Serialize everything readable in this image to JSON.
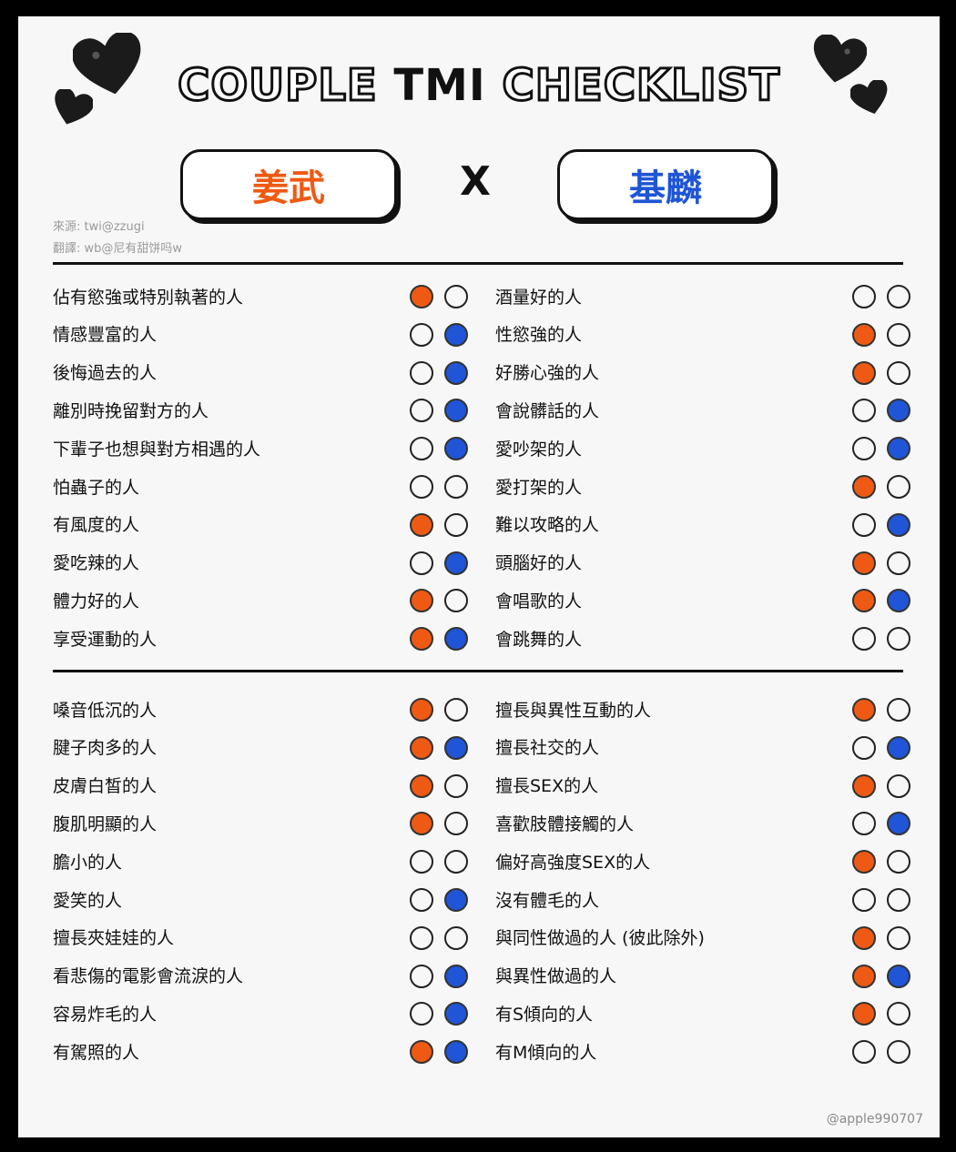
{
  "header": {
    "title_a": "COUPLE",
    "title_b": "TMI",
    "title_c": "CHECKLIST",
    "name_left": "姜武",
    "name_right": "基麟",
    "x_mark": "X"
  },
  "credits": {
    "source": "來源: twi@zzugi",
    "translation": "翻譯: wb@尼有甜饼吗w"
  },
  "colors": {
    "left_accent": "#ee5a13",
    "right_accent": "#1f55d6"
  },
  "sections": [
    {
      "left": [
        {
          "label": "佔有慾強或特別執著的人",
          "a": true,
          "b": false
        },
        {
          "label": "情感豐富的人",
          "a": false,
          "b": true
        },
        {
          "label": "後悔過去的人",
          "a": false,
          "b": true
        },
        {
          "label": "離別時挽留對方的人",
          "a": false,
          "b": true
        },
        {
          "label": "下輩子也想與對方相遇的人",
          "a": false,
          "b": true
        },
        {
          "label": "怕蟲子的人",
          "a": false,
          "b": false
        },
        {
          "label": "有風度的人",
          "a": true,
          "b": false
        },
        {
          "label": "愛吃辣的人",
          "a": false,
          "b": true
        },
        {
          "label": "體力好的人",
          "a": true,
          "b": false
        },
        {
          "label": "享受運動的人",
          "a": true,
          "b": true
        }
      ],
      "right": [
        {
          "label": "酒量好的人",
          "a": false,
          "b": false
        },
        {
          "label": "性慾強的人",
          "a": true,
          "b": false
        },
        {
          "label": "好勝心強的人",
          "a": true,
          "b": false
        },
        {
          "label": "會說髒話的人",
          "a": false,
          "b": true
        },
        {
          "label": "愛吵架的人",
          "a": false,
          "b": true
        },
        {
          "label": "愛打架的人",
          "a": true,
          "b": false
        },
        {
          "label": "難以攻略的人",
          "a": false,
          "b": true
        },
        {
          "label": "頭腦好的人",
          "a": true,
          "b": false
        },
        {
          "label": "會唱歌的人",
          "a": true,
          "b": true
        },
        {
          "label": "會跳舞的人",
          "a": false,
          "b": false
        }
      ]
    },
    {
      "left": [
        {
          "label": "嗓音低沉的人",
          "a": true,
          "b": false
        },
        {
          "label": "腱子肉多的人",
          "a": true,
          "b": true
        },
        {
          "label": "皮膚白皙的人",
          "a": true,
          "b": false
        },
        {
          "label": "腹肌明顯的人",
          "a": true,
          "b": false
        },
        {
          "label": "膽小的人",
          "a": false,
          "b": false
        },
        {
          "label": "愛笑的人",
          "a": false,
          "b": true
        },
        {
          "label": "擅長夾娃娃的人",
          "a": false,
          "b": false
        },
        {
          "label": "看悲傷的電影會流淚的人",
          "a": false,
          "b": true
        },
        {
          "label": "容易炸毛的人",
          "a": false,
          "b": true
        },
        {
          "label": "有駕照的人",
          "a": true,
          "b": true
        }
      ],
      "right": [
        {
          "label": "擅長與異性互動的人",
          "a": true,
          "b": false
        },
        {
          "label": "擅長社交的人",
          "a": false,
          "b": true
        },
        {
          "label": "擅長SEX的人",
          "a": true,
          "b": false
        },
        {
          "label": "喜歡肢體接觸的人",
          "a": false,
          "b": true
        },
        {
          "label": "偏好高強度SEX的人",
          "a": true,
          "b": false
        },
        {
          "label": "沒有體毛的人",
          "a": false,
          "b": false
        },
        {
          "label": "與同性做過的人 (彼此除外)",
          "a": true,
          "b": false
        },
        {
          "label": "與異性做過的人",
          "a": true,
          "b": true
        },
        {
          "label": "有S傾向的人",
          "a": true,
          "b": false
        },
        {
          "label": "有M傾向的人",
          "a": false,
          "b": false
        }
      ]
    }
  ],
  "watermark": "@apple990707"
}
